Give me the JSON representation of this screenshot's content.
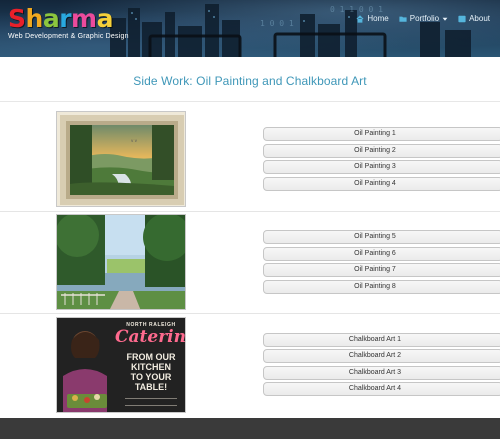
{
  "header": {
    "logo_letters": [
      "S",
      "h",
      "a",
      "r",
      "m",
      "a"
    ],
    "logo_tagline": "Web Development & Graphic Design",
    "nav": [
      {
        "label": "Home",
        "icon": "home-icon"
      },
      {
        "label": "Portfolio",
        "icon": "folder-icon",
        "dropdown": true
      },
      {
        "label": "About",
        "icon": "person-icon"
      }
    ]
  },
  "colors": {
    "logo": [
      "#e8202a",
      "#f2a91f",
      "#8cc63e",
      "#29a8df",
      "#ec4b9c",
      "#f6d13a"
    ],
    "title": "#3f97b8",
    "footer": "#3a3a3a"
  },
  "main": {
    "title": "Side Work: Oil Painting and Chalkboard Art",
    "sections": [
      {
        "image_name": "framed-oil-painting-image",
        "buttons": [
          "Oil Painting 1",
          "Oil Painting 2",
          "Oil Painting 3",
          "Oil Painting 4"
        ]
      },
      {
        "image_name": "lake-oil-painting-image",
        "buttons": [
          "Oil Painting 5",
          "Oil Painting 6",
          "Oil Painting 7",
          "Oil Painting 8"
        ]
      },
      {
        "image_name": "chalkboard-art-image",
        "buttons": [
          "Chalkboard Art 1",
          "Chalkboard Art 2",
          "Chalkboard Art 3",
          "Chalkboard Art 4"
        ],
        "chalkboard": {
          "brand_top": "NORTH RALEIGH",
          "brand": "Catering",
          "lines": [
            "FROM OUR",
            "KITCHEN",
            "TO YOUR",
            "TABLE!"
          ]
        }
      }
    ]
  }
}
